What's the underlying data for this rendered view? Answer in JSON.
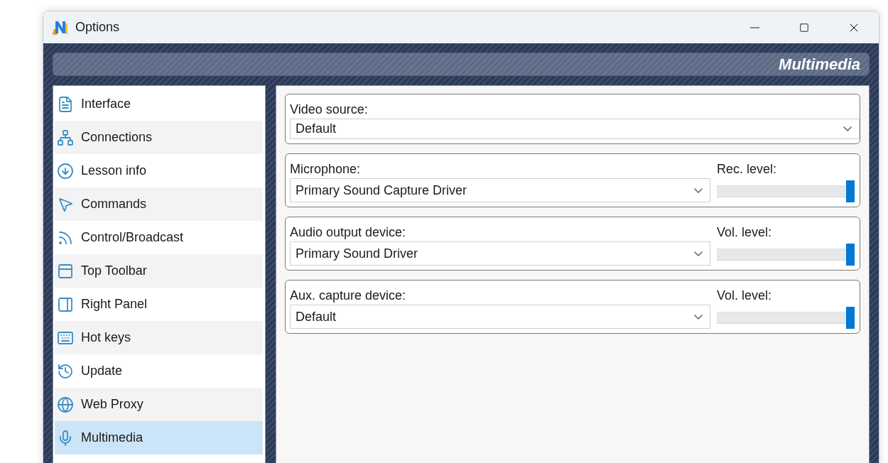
{
  "window": {
    "title": "Options"
  },
  "header": {
    "title": "Multimedia"
  },
  "sidebar": {
    "items": [
      {
        "label": "Interface",
        "selected": false
      },
      {
        "label": "Connections",
        "selected": false
      },
      {
        "label": "Lesson info",
        "selected": false
      },
      {
        "label": "Commands",
        "selected": false
      },
      {
        "label": "Control/Broadcast",
        "selected": false
      },
      {
        "label": "Top Toolbar",
        "selected": false
      },
      {
        "label": "Right Panel",
        "selected": false
      },
      {
        "label": "Hot keys",
        "selected": false
      },
      {
        "label": "Update",
        "selected": false
      },
      {
        "label": "Web Proxy",
        "selected": false
      },
      {
        "label": "Multimedia",
        "selected": true
      }
    ]
  },
  "groups": [
    {
      "kind": "combo",
      "label": "Video source:",
      "value": "Default"
    },
    {
      "kind": "combo-slider",
      "label": "Microphone:",
      "value": "Primary Sound Capture Driver",
      "slider_label": "Rec. level:",
      "level": 1
    },
    {
      "kind": "combo-slider",
      "label": "Audio output device:",
      "value": "Primary Sound Driver",
      "slider_label": "Vol. level:",
      "level": 1
    },
    {
      "kind": "combo-slider",
      "label": "Aux. capture device:",
      "value": "Default",
      "slider_label": "Vol. level:",
      "level": 1
    }
  ]
}
